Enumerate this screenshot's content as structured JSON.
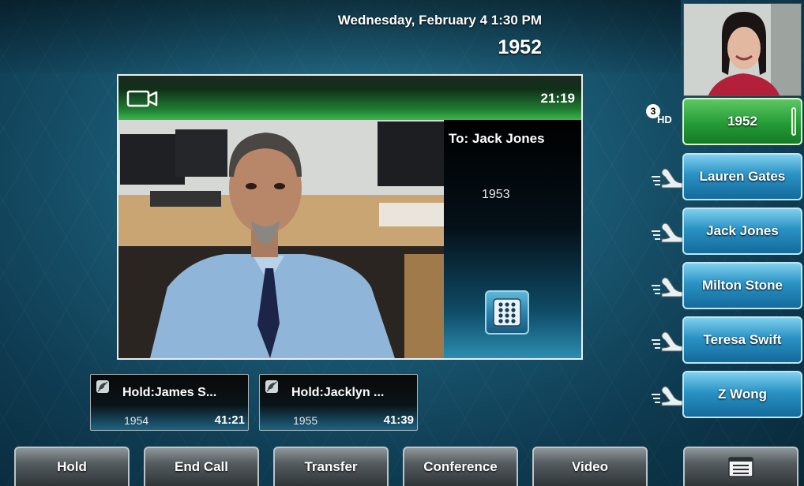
{
  "status": {
    "datetime": "Wednesday, February 4  1:30 PM",
    "my_extension": "1952"
  },
  "active_call": {
    "timer": "21:19",
    "to_label": "To: Jack Jones",
    "number": "1953"
  },
  "held_calls": [
    {
      "name": "Hold:James S...",
      "extension": "1954",
      "duration": "41:21"
    },
    {
      "name": "Hold:Jacklyn ...",
      "extension": "1955",
      "duration": "41:39"
    }
  ],
  "line_keys": {
    "active": {
      "label": "1952",
      "count": "3",
      "badge": "HD"
    },
    "contacts": [
      {
        "label": "Lauren Gates"
      },
      {
        "label": "Jack Jones"
      },
      {
        "label": "Milton Stone"
      },
      {
        "label": "Teresa Swift"
      },
      {
        "label": "Z Wong"
      }
    ]
  },
  "softkeys": {
    "hold": "Hold",
    "end_call": "End Call",
    "transfer": "Transfer",
    "conference": "Conference",
    "video": "Video"
  },
  "icons": {
    "camera": "video-camera-icon",
    "hold": "hold-status-icon",
    "dialpad": "dialpad-icon",
    "phone": "handset-icon",
    "menu": "menu-icon"
  },
  "colors": {
    "active_line": "#259b36",
    "line_key": "#2a92c4",
    "softkey": "#555c60"
  }
}
